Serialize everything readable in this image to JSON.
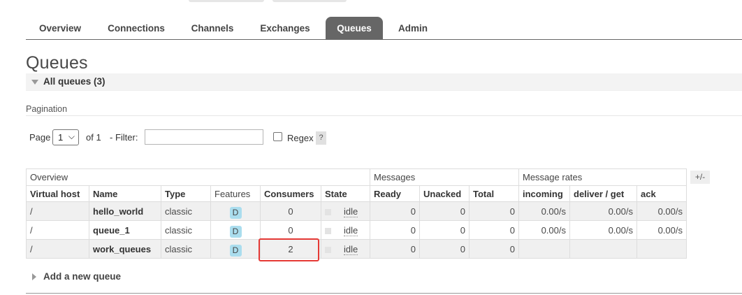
{
  "nav": {
    "tabs": [
      {
        "label": "Overview",
        "active": false
      },
      {
        "label": "Connections",
        "active": false
      },
      {
        "label": "Channels",
        "active": false
      },
      {
        "label": "Exchanges",
        "active": false
      },
      {
        "label": "Queues",
        "active": true
      },
      {
        "label": "Admin",
        "active": false
      }
    ]
  },
  "page": {
    "title": "Queues"
  },
  "section": {
    "label": "All queues (3)"
  },
  "pagination": {
    "label": "Pagination",
    "page_label": "Page",
    "page_value": "1",
    "of_label": "of 1",
    "filter_label": "- Filter:",
    "filter_value": "",
    "regex_label": "Regex",
    "regex_checked": false,
    "help_label": "?"
  },
  "table": {
    "groups": [
      "Overview",
      "Messages",
      "Message rates"
    ],
    "columns": [
      "Virtual host",
      "Name",
      "Type",
      "Features",
      "Consumers",
      "State",
      "Ready",
      "Unacked",
      "Total",
      "incoming",
      "deliver / get",
      "ack"
    ],
    "rows": [
      {
        "vhost": "/",
        "name": "hello_world",
        "type": "classic",
        "features": "D",
        "consumers": "0",
        "state": "idle",
        "ready": "0",
        "unacked": "0",
        "total": "0",
        "incoming": "0.00/s",
        "deliver_get": "0.00/s",
        "ack": "0.00/s"
      },
      {
        "vhost": "/",
        "name": "queue_1",
        "type": "classic",
        "features": "D",
        "consumers": "0",
        "state": "idle",
        "ready": "0",
        "unacked": "0",
        "total": "0",
        "incoming": "0.00/s",
        "deliver_get": "0.00/s",
        "ack": "0.00/s"
      },
      {
        "vhost": "/",
        "name": "work_queues",
        "type": "classic",
        "features": "D",
        "consumers": "2",
        "state": "idle",
        "ready": "0",
        "unacked": "0",
        "total": "0",
        "incoming": "",
        "deliver_get": "",
        "ack": ""
      }
    ],
    "plus_minus": "+/-"
  },
  "add_queue": {
    "label": "Add a new queue"
  },
  "colors": {
    "active_tab": "#666666",
    "feature_badge": "#aaddee",
    "highlight": "#e53935",
    "odd_row": "#f0f0f0"
  }
}
